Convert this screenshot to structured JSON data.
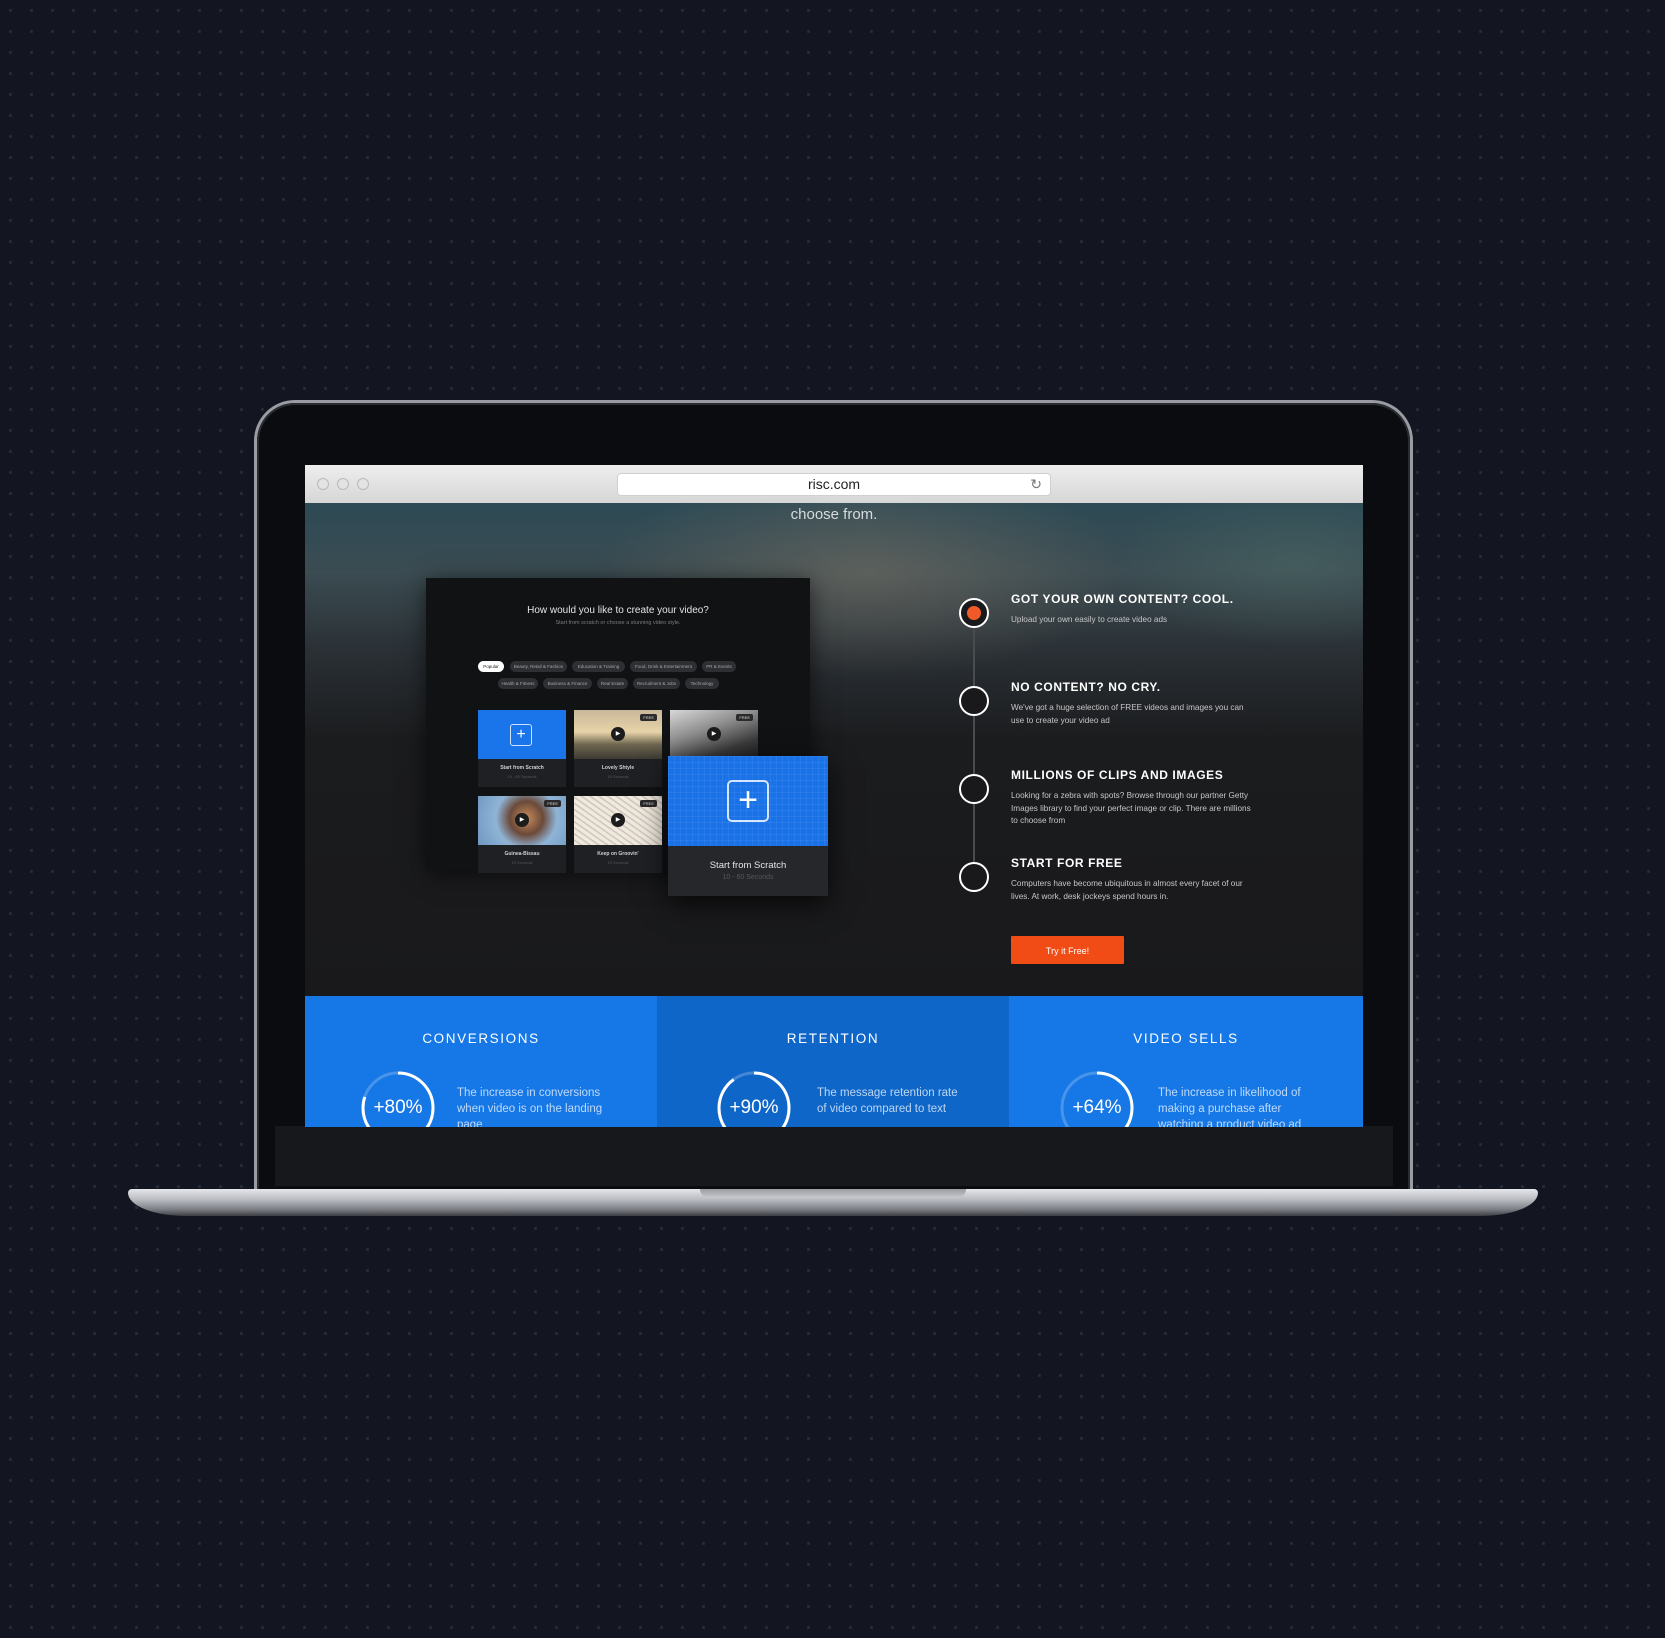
{
  "browser": {
    "url": "risc.com",
    "reload_icon": "reload-icon"
  },
  "hero": {
    "caption": "choose from."
  },
  "app": {
    "title": "How would you like to create your video?",
    "subtitle": "Start from scratch or choose a stunning video style.",
    "categories": [
      "Popular",
      "Beauty, Retail & Fashion",
      "Education & Training",
      "Food, Drink & Entertainment",
      "PR & Events",
      "Health & Fitness",
      "Business & Finance",
      "Real Estate",
      "Recruitment & Jobs",
      "Technology"
    ],
    "free_label": "FREE",
    "templates": [
      {
        "name": "Start from Scratch",
        "meta": "10 - 60 Seconds"
      },
      {
        "name": "Lovely Shtyle",
        "meta": "15 Seconds"
      },
      {
        "name": "",
        "meta": ""
      },
      {
        "name": "Guinea-Bissau",
        "meta": "15 Seconds"
      },
      {
        "name": "Keep on Groovin'",
        "meta": "15 Seconds"
      }
    ],
    "featured": {
      "name": "Start from Scratch",
      "meta": "10 - 60 Seconds"
    }
  },
  "steps": [
    {
      "title": "GOT YOUR OWN CONTENT? COOL.",
      "text": "Upload your own easily to create video ads",
      "active": true
    },
    {
      "title": "NO CONTENT? NO CRY.",
      "text": "We've got a huge selection of FREE videos and images you can use to create your video ad",
      "active": false
    },
    {
      "title": "MILLIONS OF CLIPS AND IMAGES",
      "text": "Looking for a zebra with spots? Browse through our partner Getty Images library to find your perfect image or clip. There are millions to choose from",
      "active": false
    },
    {
      "title": "START FOR FREE",
      "text": "Computers have become ubiquitous in almost every facet of our lives. At work, desk jockeys spend hours in.",
      "active": false
    }
  ],
  "cta": {
    "label": "Try it Free!"
  },
  "stats": [
    {
      "title": "CONVERSIONS",
      "value": "+80%",
      "percent": 80,
      "text": "The increase in conversions when video is on the landing page"
    },
    {
      "title": "RETENTION",
      "value": "+90%",
      "percent": 90,
      "text": "The message retention rate of video compared to text"
    },
    {
      "title": "VIDEO SELLS",
      "value": "+64%",
      "percent": 64,
      "text": "The increase in likelihood of making a purchase after watching a product video ad"
    }
  ],
  "colors": {
    "accent_orange": "#f14c15",
    "brand_blue": "#1677e6",
    "brand_blue_dark": "#0f66c9"
  }
}
